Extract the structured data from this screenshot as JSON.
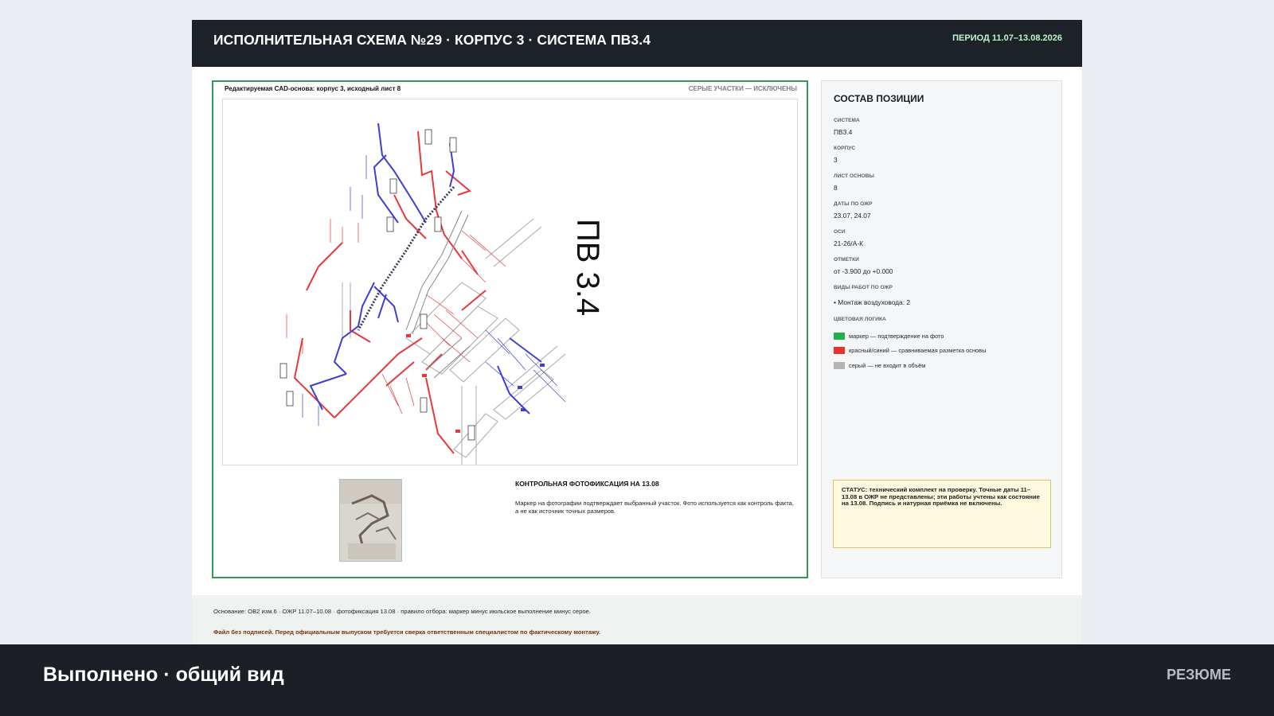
{
  "header": {
    "title": "ИСПОЛНИТЕЛЬНАЯ СХЕМА №29  ·  КОРПУС 3  ·  СИСТЕМА ПВ3.4",
    "period": "ПЕРИОД 11.07–13.08.2026"
  },
  "drawing": {
    "caption_left": "Редактируемая CAD-основа: корпус 3, исходный лист 8",
    "caption_right": "СЕРЫЕ УЧАСТКИ — ИСКЛЮЧЕНЫ",
    "system_label": "ПВ 3.4",
    "colors": {
      "red": "#e8393b",
      "blue": "#3d3fd6",
      "gray": "#9a9a9a",
      "frame": "#2e9a5a"
    }
  },
  "photo": {
    "title": "КОНТРОЛЬНАЯ ФОТОФИКСАЦИЯ НА 13.08",
    "text": "Маркер на фотографии подтверждает выбранный участок. Фото используется как контроль факта, а не как источник точных размеров."
  },
  "panel": {
    "title": "СОСТАВ ПОЗИЦИИ",
    "fields": [
      {
        "label": "СИСТЕМА",
        "value": "ПВ3.4"
      },
      {
        "label": "КОРПУС",
        "value": "3"
      },
      {
        "label": "ЛИСТ ОСНОВЫ",
        "value": "8"
      },
      {
        "label": "ДАТЫ ПО ОЖР",
        "value": "23.07, 24.07"
      },
      {
        "label": "ОСИ",
        "value": "21-26/А-К"
      },
      {
        "label": "ОТМЕТКИ",
        "value": "от -3.900 до +0.000"
      },
      {
        "label": "ВИДЫ РАБОТ ПО ОЖР",
        "value": "• Монтаж воздуховода: 2"
      }
    ],
    "legend_title": "ЦВЕТОВАЯ ЛОГИКА",
    "legend": [
      {
        "color": "#22b04b",
        "text": "маркер — подтверждение на фото"
      },
      {
        "color": "#e8322b",
        "text": "красный/синий — сравниваемая разметка основы"
      },
      {
        "color": "#b4b4b4",
        "text": "серый — не входит в объём"
      }
    ],
    "status": "СТАТУС: технический комплект на проверку. Точные даты 11–13.08 в ОЖР не представлены; эти работы учтены как состояние на 13.08. Подпись и натурная приёмка не включены."
  },
  "footer": {
    "basis": "Основание: ОВ2 изм.6 · ОЖР 11.07–10.08 · фотофиксация 13.08 · правило отбора: маркер минус июльское выполнение минус серое.",
    "warning": "Файл без подписей. Перед официальным выпуском требуется сверка ответственным специалистом по фактическому монтажу."
  },
  "bottom": {
    "title": "Выполнено · общий вид",
    "link": "РЕЗЮМЕ"
  }
}
